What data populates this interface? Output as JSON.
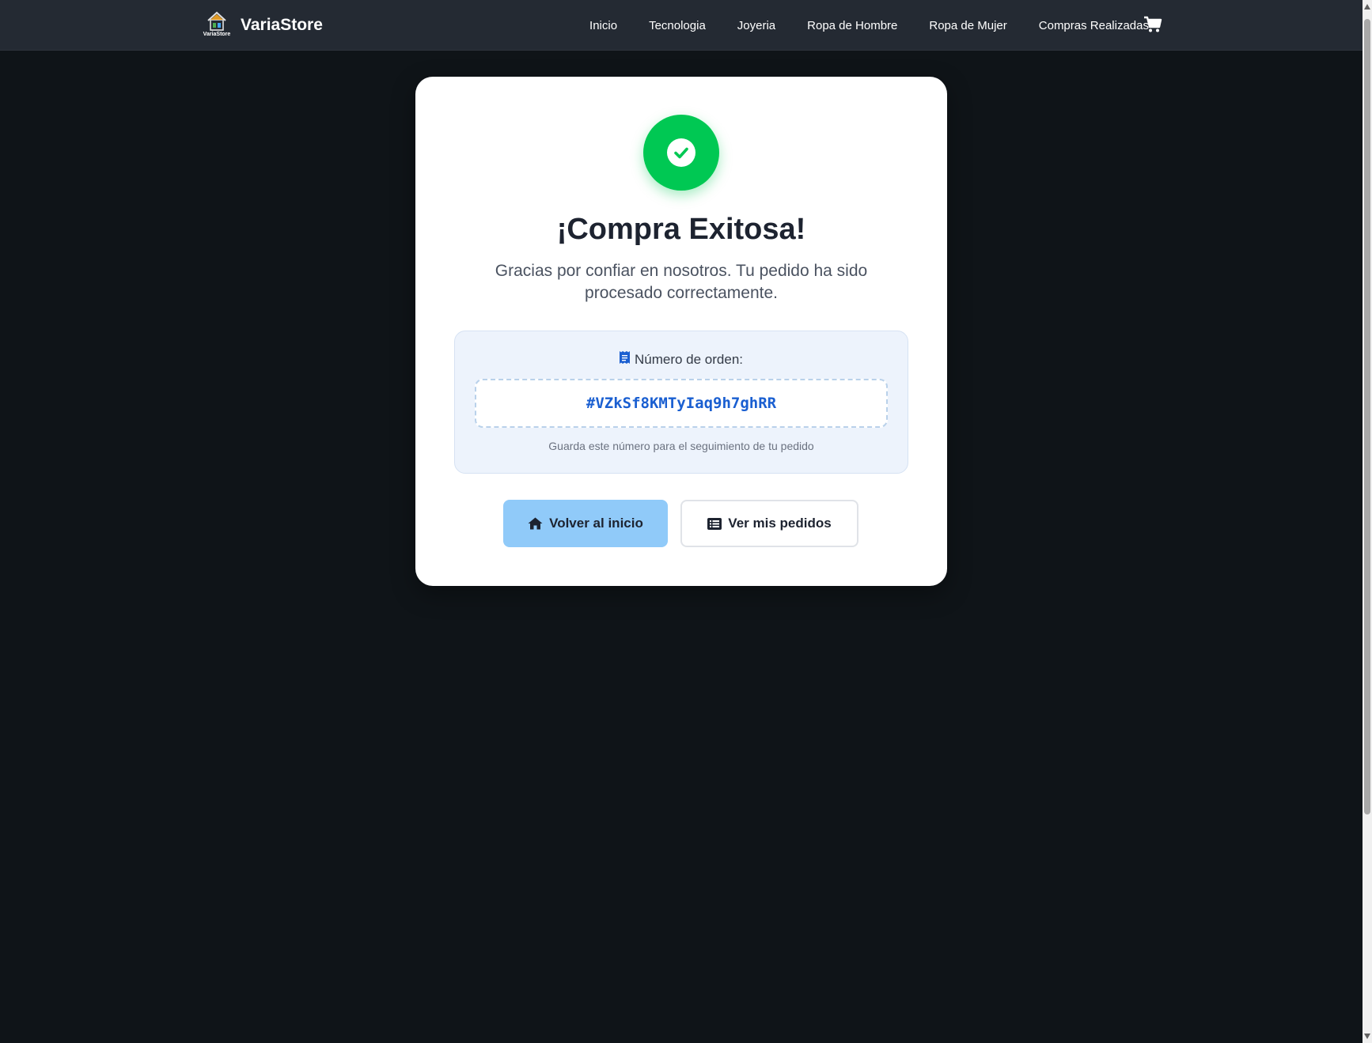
{
  "brand": {
    "logo_text": "VariaStore",
    "name": "VariaStore"
  },
  "nav": {
    "links": [
      "Inicio",
      "Tecnologia",
      "Joyeria",
      "Ropa de Hombre",
      "Ropa de Mujer",
      "Compras Realizadas"
    ],
    "cart_icon": "shopping-cart-icon"
  },
  "success": {
    "icon": "check-circle-icon",
    "title": "¡Compra Exitosa!",
    "message": "Gracias por confiar en nosotros. Tu pedido ha sido procesado correctamente."
  },
  "order": {
    "icon": "receipt-icon",
    "label": "Número de orden:",
    "number": "#VZkSf8KMTyIaq9h7ghRR",
    "hint": "Guarda este número para el seguimiento de tu pedido"
  },
  "actions": {
    "home_label": "Volver al inicio",
    "home_icon": "home-icon",
    "orders_label": "Ver mis pedidos",
    "orders_icon": "list-icon"
  },
  "colors": {
    "navbar": "#242a33",
    "background": "#0f1418",
    "success": "#00c853",
    "primary_button": "#90caf9",
    "order_number": "#1a5fd1"
  }
}
